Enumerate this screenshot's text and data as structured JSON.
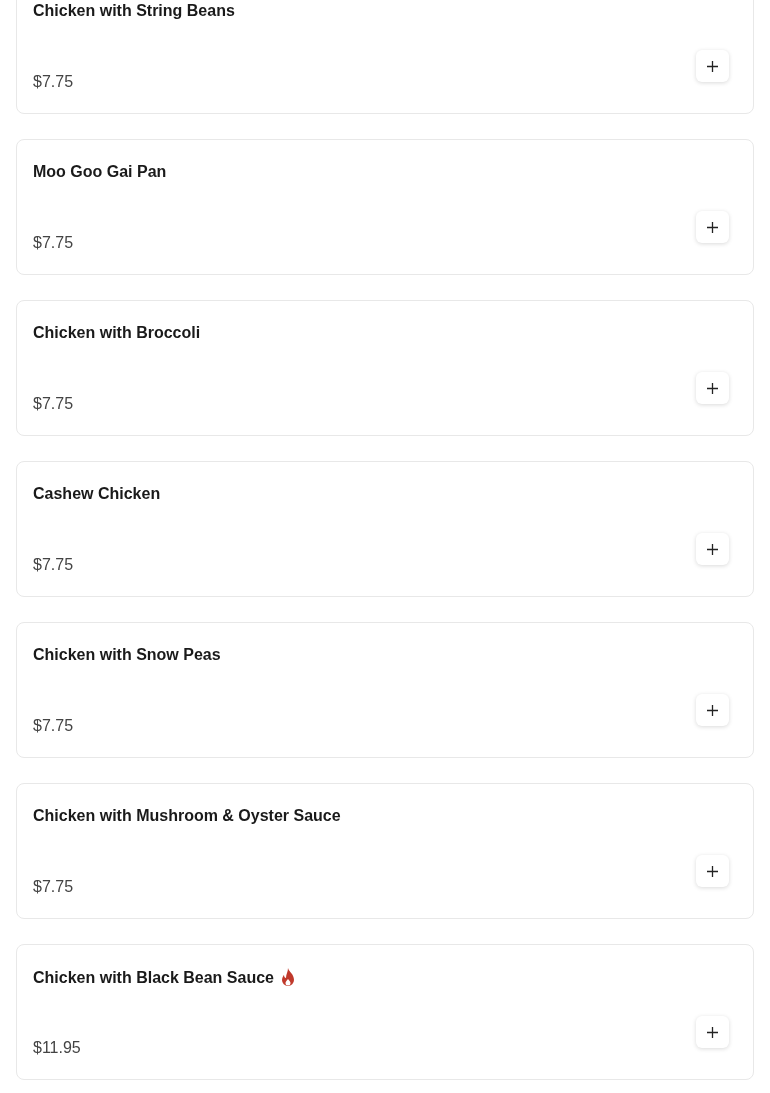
{
  "items": [
    {
      "name": "Chicken with String Beans",
      "price": "$7.75",
      "spicy": false
    },
    {
      "name": "Moo Goo Gai Pan",
      "price": "$7.75",
      "spicy": false
    },
    {
      "name": "Chicken with Broccoli",
      "price": "$7.75",
      "spicy": false
    },
    {
      "name": "Cashew Chicken",
      "price": "$7.75",
      "spicy": false
    },
    {
      "name": "Chicken with Snow Peas",
      "price": "$7.75",
      "spicy": false
    },
    {
      "name": "Chicken with Mushroom & Oyster Sauce",
      "price": "$7.75",
      "spicy": false
    },
    {
      "name": "Chicken with Black Bean Sauce",
      "price": "$11.95",
      "spicy": true
    }
  ]
}
